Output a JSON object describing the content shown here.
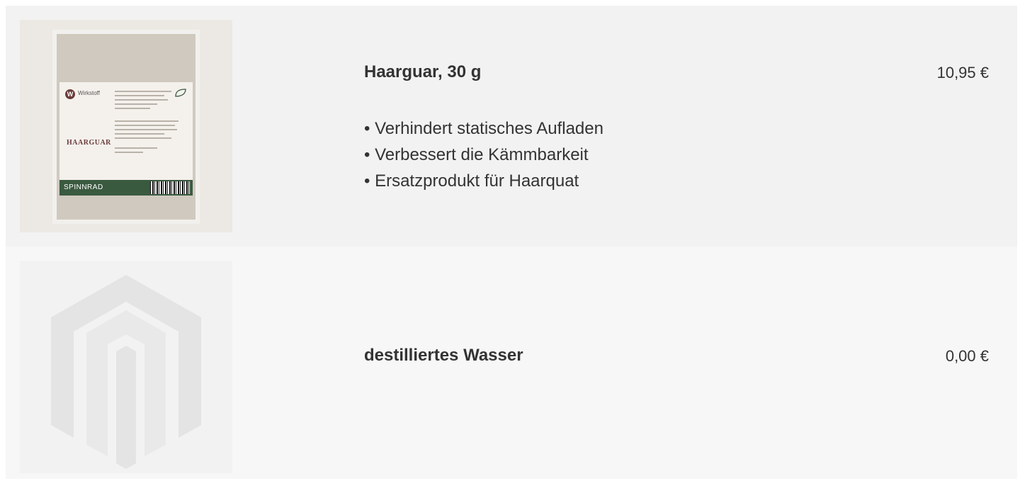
{
  "items": [
    {
      "title": "Haarguar, 30 g",
      "price": "10,95 €",
      "features": [
        "Verhindert statisches Aufladen",
        "Verbessert die Kämmbarkeit",
        "Ersatzprodukt für Haarquat"
      ],
      "image": {
        "type": "product-photo",
        "brand": "Wirkstoff",
        "product_name": "HAARGUAR",
        "maker": "SPINNRAD"
      }
    },
    {
      "title": "destilliertes Wasser",
      "price": "0,00 €",
      "image": {
        "type": "placeholder-logo"
      }
    }
  ],
  "colors": {
    "row_1_bg": "#f2f2f2",
    "row_2_bg": "#f7f7f7",
    "text": "#333333",
    "package_green": "#3a5a40",
    "brand_maroon": "#6b3b3b"
  }
}
